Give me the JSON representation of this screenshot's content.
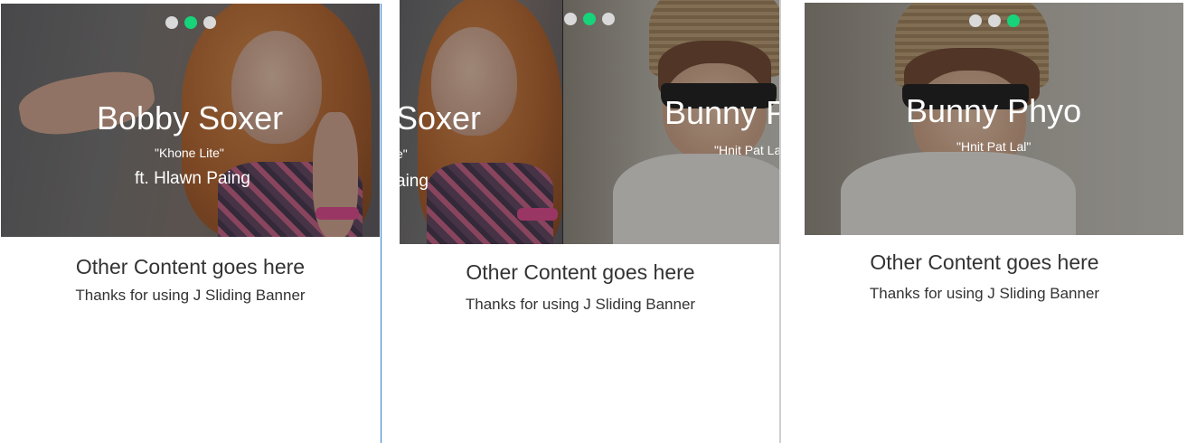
{
  "panels": [
    {
      "slides": [
        {
          "title": "Bobby Soxer",
          "song": "\"Khone Lite\"",
          "feat": "ft. Hlawn Paing"
        }
      ],
      "content": {
        "title": "Other Content goes here",
        "subtitle": "Thanks for using J Sliding Banner"
      }
    },
    {
      "slides": [
        {
          "title": "Soxer",
          "song": "e\"",
          "feat": "aing"
        },
        {
          "title": "Bunny P",
          "song": "\"Hnit Pat La"
        }
      ],
      "content": {
        "title": "Other Content goes here",
        "subtitle": "Thanks for using J Sliding Banner"
      }
    },
    {
      "slides": [
        {
          "title": "Bunny Phyo",
          "song": "\"Hnit Pat Lal\""
        }
      ],
      "content": {
        "title": "Other Content goes here",
        "subtitle": "Thanks for using J Sliding Banner"
      }
    }
  ],
  "indicator": {
    "count": 3,
    "active_index": [
      1,
      1,
      2
    ],
    "active_color": "#17d37a",
    "inactive_color": "#d9d9d9"
  }
}
